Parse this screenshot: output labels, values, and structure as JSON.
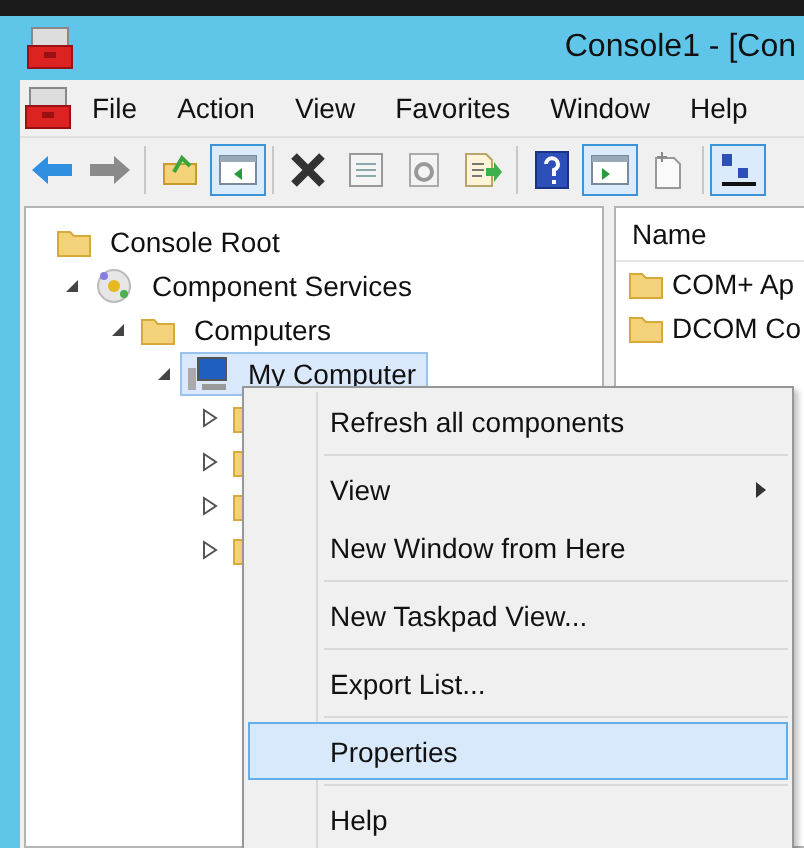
{
  "window": {
    "title": "Console1 - [Con"
  },
  "menu_bar": [
    "File",
    "Action",
    "View",
    "Favorites",
    "Window",
    "Help"
  ],
  "toolbar": [
    {
      "kind": "back",
      "pressed": false
    },
    {
      "kind": "forward",
      "pressed": false
    },
    {
      "kind": "separator"
    },
    {
      "kind": "up",
      "pressed": false
    },
    {
      "kind": "tree-pane",
      "pressed": true
    },
    {
      "kind": "separator"
    },
    {
      "kind": "delete",
      "pressed": false
    },
    {
      "kind": "properties",
      "pressed": false
    },
    {
      "kind": "refresh",
      "pressed": false
    },
    {
      "kind": "export",
      "pressed": false
    },
    {
      "kind": "separator"
    },
    {
      "kind": "help",
      "pressed": false
    },
    {
      "kind": "action-pane",
      "pressed": true
    },
    {
      "kind": "new",
      "pressed": false
    },
    {
      "kind": "separator"
    },
    {
      "kind": "view",
      "pressed": true
    }
  ],
  "tree": [
    {
      "label": "Console Root",
      "kind": "folder",
      "selected": false,
      "children": [
        {
          "label": "Component Services",
          "kind": "services",
          "expanded": true,
          "selected": false,
          "children": [
            {
              "label": "Computers",
              "kind": "folder",
              "expanded": true,
              "selected": false,
              "children": [
                {
                  "label": "My Computer",
                  "kind": "computer",
                  "expanded": true,
                  "selected": true,
                  "children": [
                    {
                      "kind": "folder",
                      "expanded": false,
                      "selected": false
                    },
                    {
                      "kind": "folder",
                      "expanded": false,
                      "selected": false
                    },
                    {
                      "kind": "folder",
                      "expanded": false,
                      "selected": false
                    },
                    {
                      "kind": "folder",
                      "expanded": false,
                      "selected": false
                    }
                  ]
                }
              ]
            }
          ]
        }
      ]
    }
  ],
  "list": {
    "columns": [
      "Name"
    ],
    "rows": [
      "COM+ Ap",
      "DCOM Co"
    ]
  },
  "context_menu": [
    {
      "kind": "item",
      "label": "Refresh all components",
      "selected": false
    },
    {
      "kind": "separator"
    },
    {
      "kind": "submenu",
      "label": "View",
      "selected": false
    },
    {
      "kind": "item",
      "label": "New Window from Here",
      "selected": false
    },
    {
      "kind": "separator"
    },
    {
      "kind": "item",
      "label": "New Taskpad View...",
      "selected": false
    },
    {
      "kind": "separator"
    },
    {
      "kind": "item",
      "label": "Export List...",
      "selected": false
    },
    {
      "kind": "separator"
    },
    {
      "kind": "item",
      "label": "Properties",
      "selected": true
    },
    {
      "kind": "separator"
    },
    {
      "kind": "item",
      "label": "Help",
      "selected": false
    }
  ]
}
